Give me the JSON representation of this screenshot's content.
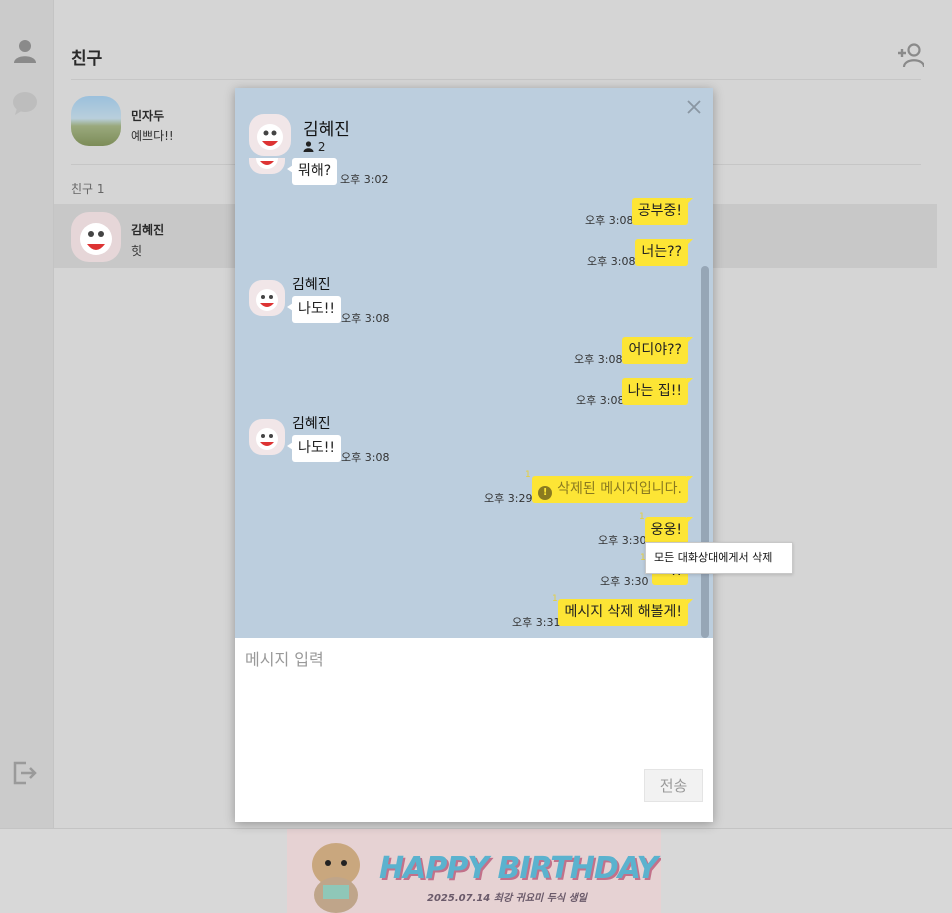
{
  "app": {
    "title": "친구",
    "my_profile": {
      "name": "민자두",
      "status": "예쁘다!!"
    },
    "friend_section_label": "친구 1",
    "friends": [
      {
        "name": "김혜진",
        "status": "힛"
      }
    ]
  },
  "chat": {
    "partner_name": "김혜진",
    "member_count": "2",
    "messages": [
      {
        "from": "other",
        "text": "뭐해?",
        "time": "오후 3:02"
      },
      {
        "from": "me",
        "text": "공부중!",
        "time": "오후 3:08"
      },
      {
        "from": "me",
        "text": "너는??",
        "time": "오후 3:08"
      },
      {
        "from": "other",
        "sender": "김혜진",
        "text": "나도!!",
        "time": "오후 3:08"
      },
      {
        "from": "me",
        "text": "어디야??",
        "time": "오후 3:08"
      },
      {
        "from": "me",
        "text": "나는 집!!",
        "time": "오후 3:08"
      },
      {
        "from": "other",
        "sender": "김혜진",
        "text": "나도!!",
        "time": "오후 3:08"
      },
      {
        "from": "me",
        "text": "삭제된 메시지입니다.",
        "time": "오후 3:29",
        "unread": "1",
        "deleted": true
      },
      {
        "from": "me",
        "text": "웅웅!",
        "time": "오후 3:30",
        "unread": "1"
      },
      {
        "from": "me",
        "text": "ㅋ!!",
        "time": "오후 3:30",
        "unread": "1"
      },
      {
        "from": "me",
        "text": "메시지 삭제 해볼게!",
        "time": "오후 3:31",
        "unread": "1"
      }
    ],
    "context_menu": {
      "delete_for_all": "모든 대화상대에게서 삭제"
    },
    "composer": {
      "placeholder": "메시지 입력",
      "send_label": "전송"
    }
  },
  "banner": {
    "title": "HAPPY BIRTHDAY",
    "subtitle": "2025.07.14 최강 귀요미 두식 생일"
  },
  "icons": {
    "rail": [
      "person-icon",
      "chat-bubble-icon",
      "logout-icon"
    ],
    "header": [
      "add-friend-icon",
      "close-icon"
    ]
  },
  "colors": {
    "chat_background": "#bccede",
    "my_bubble": "#fde535",
    "other_bubble": "#ffffff",
    "unread_count": "#e6d03a"
  }
}
